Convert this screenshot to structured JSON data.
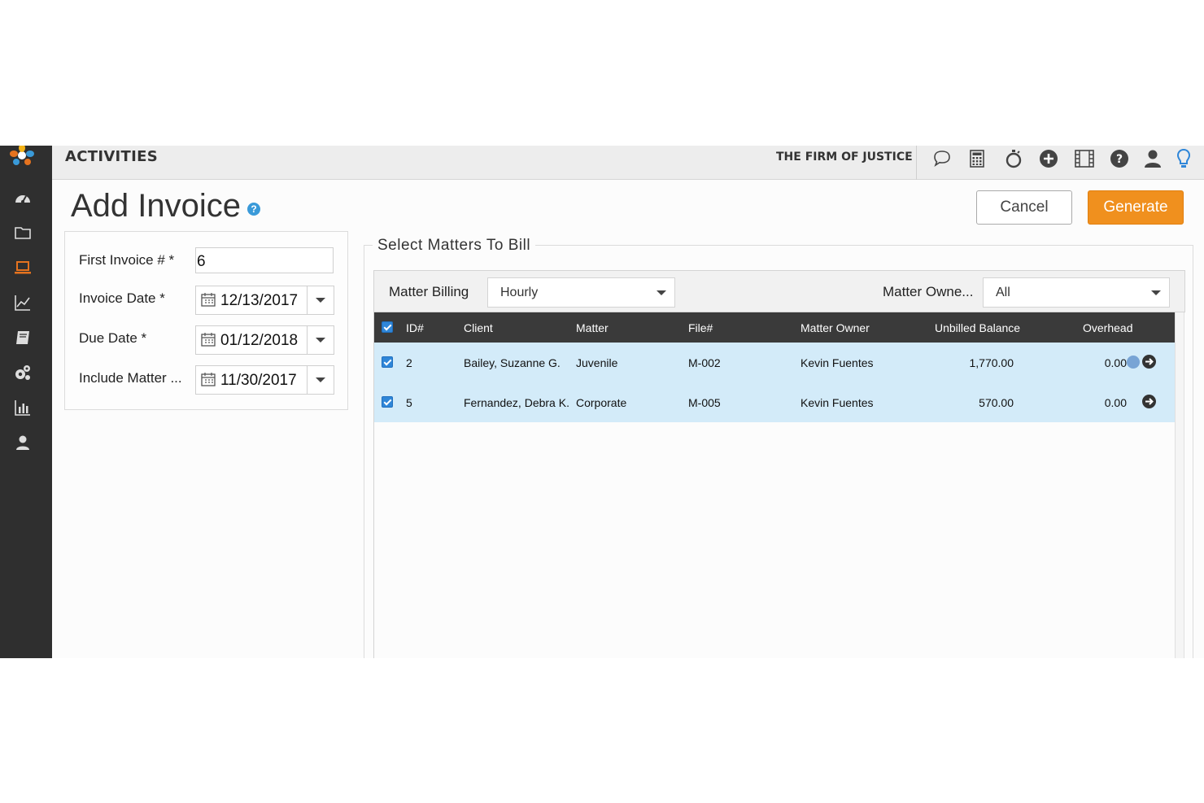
{
  "topbar": {
    "section_title": "ACTIVITIES",
    "firm_name": "THE FIRM OF JUSTICE",
    "icons": [
      "chat-icon",
      "calculator-icon",
      "timer-icon",
      "add-icon",
      "film-icon",
      "help-icon",
      "user-icon",
      "lightbulb-icon"
    ]
  },
  "sidebar": {
    "items": [
      "dashboard-icon",
      "folder-icon",
      "laptop-icon",
      "chart-icon",
      "book-icon",
      "settings-icon",
      "bar-chart-icon",
      "contacts-icon"
    ],
    "active_item": "laptop-icon",
    "active_color": "#e5731f"
  },
  "header": {
    "title": "Add Invoice",
    "help": "?",
    "cancel_label": "Cancel",
    "generate_label": "Generate"
  },
  "form": {
    "first_invoice_label": "First Invoice # *",
    "first_invoice_value": "6",
    "invoice_date_label": "Invoice Date *",
    "invoice_date_value": "12/13/2017",
    "due_date_label": "Due Date *",
    "due_date_value": "01/12/2018",
    "include_matter_label": "Include Matter ...",
    "include_matter_value": "11/30/2017"
  },
  "matters": {
    "legend": "Select Matters To Bill",
    "billing_label": "Matter Billing",
    "billing_value": "Hourly",
    "owner_label": "Matter Owne...",
    "owner_value": "All",
    "columns": [
      "ID#",
      "Client",
      "Matter",
      "File#",
      "Matter Owner",
      "Unbilled Balance",
      "Overhead"
    ],
    "rows": [
      {
        "id": "2",
        "client": "Bailey, Suzanne G.",
        "matter": "Juvenile",
        "file": "M-002",
        "owner": "Kevin Fuentes",
        "unbilled": "1,770.00",
        "overhead": "0.00",
        "checked": true
      },
      {
        "id": "5",
        "client": "Fernandez, Debra K.",
        "matter": "Corporate",
        "file": "M-005",
        "owner": "Kevin Fuentes",
        "unbilled": "570.00",
        "overhead": "0.00",
        "checked": true
      }
    ]
  },
  "colors": {
    "accent": "#f0901e",
    "sidebar_bg": "#2f2f2f",
    "row_selected": "#d3ebf9",
    "grid_header": "#3a3a3a"
  }
}
